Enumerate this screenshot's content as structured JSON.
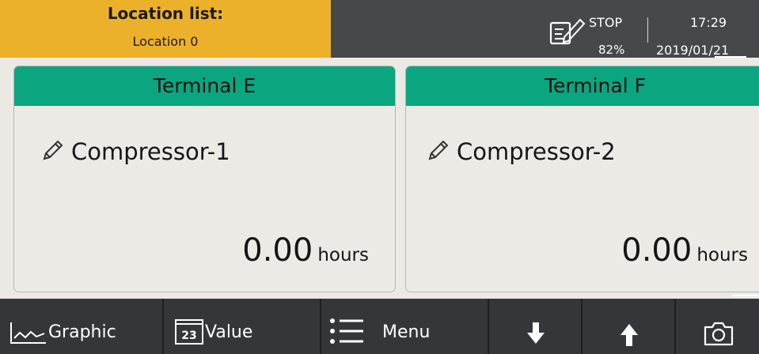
{
  "header": {
    "location_title": "Location list:",
    "location_name": "Location 0",
    "record_icon": "record-edit-icon",
    "status": "STOP",
    "percent": "82%",
    "time": "17:29",
    "date": "2019/01/21"
  },
  "panels": [
    {
      "terminal": "Terminal E",
      "icon": "pencil-icon",
      "device": "Compressor-1",
      "value": "0.00",
      "unit": "hours"
    },
    {
      "terminal": "Terminal F",
      "icon": "pencil-icon",
      "device": "Compressor-2",
      "value": "0.00",
      "unit": "hours"
    }
  ],
  "toolbar": {
    "graphic_label": "Graphic",
    "value_icon_text": "23",
    "value_label": "Value",
    "menu_label": "Menu",
    "icons": [
      "chart-line-icon",
      "value-icon",
      "menu-list-icon",
      "arrow-down-icon",
      "arrow-up-icon",
      "camera-icon"
    ]
  },
  "colors": {
    "header_bg": "#46484b",
    "location_bg": "#ecb12b",
    "terminal_header": "#0ba67f",
    "panel_bg": "#edeae6",
    "toolbar_bg": "#34363a"
  }
}
